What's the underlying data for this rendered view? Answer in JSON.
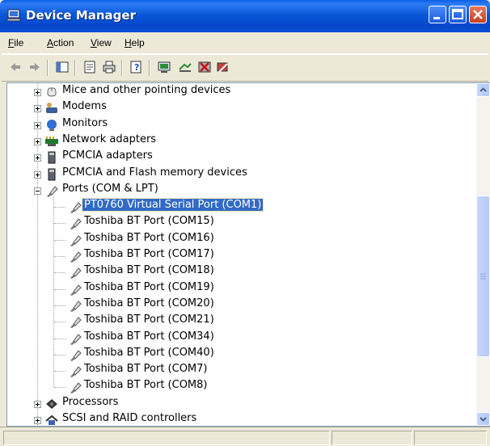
{
  "window": {
    "title": "Device Manager"
  },
  "menu": [
    {
      "prefix": "",
      "mnemonic": "F",
      "rest": "ile"
    },
    {
      "prefix": "",
      "mnemonic": "A",
      "rest": "ction"
    },
    {
      "prefix": "",
      "mnemonic": "V",
      "rest": "iew"
    },
    {
      "prefix": "",
      "mnemonic": "H",
      "rest": "elp"
    }
  ],
  "toolbar_icons": [
    "back-arrow-icon",
    "forward-arrow-icon",
    "console-tree-icon",
    "properties-icon",
    "print-icon",
    "help-icon",
    "scan-hardware-icon",
    "update-driver-icon",
    "disable-device-icon",
    "uninstall-device-icon"
  ],
  "tree": {
    "categories_above": [
      {
        "label": "Mice and other pointing devices",
        "icon": "mouse-icon"
      },
      {
        "label": "Modems",
        "icon": "modem-icon"
      },
      {
        "label": "Monitors",
        "icon": "monitor-icon"
      },
      {
        "label": "Network adapters",
        "icon": "network-adapter-icon"
      },
      {
        "label": "PCMCIA adapters",
        "icon": "pcmcia-icon"
      },
      {
        "label": "PCMCIA and Flash memory devices",
        "icon": "pcmcia-flash-icon"
      }
    ],
    "ports": {
      "label": "Ports (COM & LPT)",
      "icon": "port-connector-icon",
      "children": [
        "PT0760 Virtual Serial Port (COM1)",
        "Toshiba BT Port (COM15)",
        "Toshiba BT Port (COM16)",
        "Toshiba BT Port (COM17)",
        "Toshiba BT Port (COM18)",
        "Toshiba BT Port (COM19)",
        "Toshiba BT Port (COM20)",
        "Toshiba BT Port (COM21)",
        "Toshiba BT Port (COM34)",
        "Toshiba BT Port (COM40)",
        "Toshiba BT Port (COM7)",
        "Toshiba BT Port (COM8)"
      ]
    },
    "categories_below": [
      {
        "label": "Processors",
        "icon": "processor-icon"
      },
      {
        "label": "SCSI and RAID controllers",
        "icon": "scsi-icon"
      }
    ]
  },
  "colors": {
    "titlebar": "#0B57D9",
    "selection": "#316AC5",
    "chrome": "#ECE9D8"
  }
}
